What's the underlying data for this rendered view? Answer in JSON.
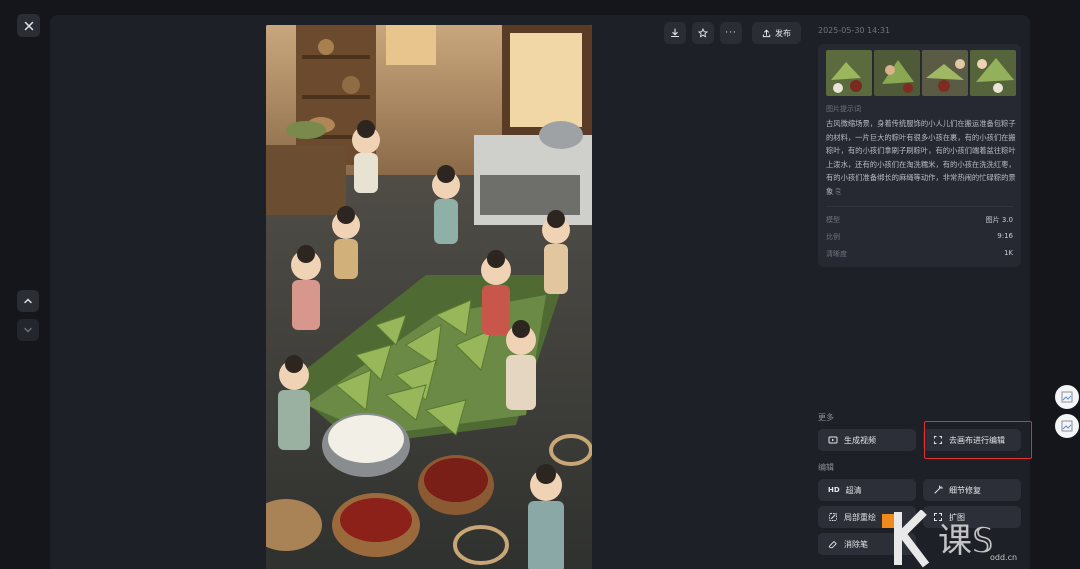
{
  "viewer": {
    "timestamp": "2025-05-30 14:31",
    "publish_label": "发布"
  },
  "info": {
    "prompt_label": "图片提示词",
    "prompt_text": "古风微缩场景，身着传统服饰的小人儿们在搬运准备包粽子的材料，一片巨大的粽叶有很多小孩在裹，有的小孩们在搬粽叶，有的小孩们拿刷子刷粽叶，有的小孩们端着盆往粽叶上泼水，还有的小孩们在淘洗糯米，有的小孩在洗洗红枣，有的小孩们准备绑长的麻绳等动作，非常热闹的忙碌粽的景象",
    "meta": [
      {
        "key": "模型",
        "value": "图片 3.0"
      },
      {
        "key": "比例",
        "value": "9:16"
      },
      {
        "key": "清晰度",
        "value": "1K"
      }
    ]
  },
  "more": {
    "title": "更多",
    "generate_video": "生成视频",
    "canvas_edit": "去画布进行编辑"
  },
  "edit": {
    "title": "编辑",
    "upscale": "超清",
    "detail_fix": "细节修复",
    "local_redraw": "局部重绘",
    "expand": "扩图",
    "eraser": "消除笔",
    "hd_icon": "HD"
  },
  "watermark": {
    "text": "odd.cn"
  },
  "colors": {
    "background": "#14161c",
    "stage": "#1d2027",
    "card": "#262931",
    "button": "#2c2f37",
    "highlight": "#e0322c",
    "watermark_orange": "#f08a1c"
  }
}
